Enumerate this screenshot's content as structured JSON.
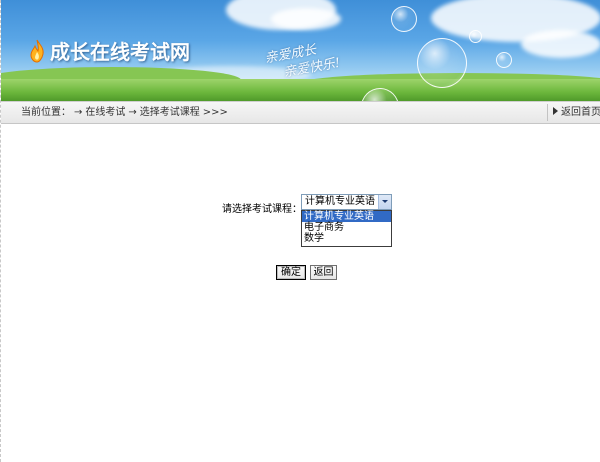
{
  "header": {
    "site_title": "成长在线考试网",
    "slogan_line1": "亲爱成长",
    "slogan_line2": "亲爱快乐!",
    "logo_icon": "flame-icon"
  },
  "breadcrumb": {
    "prefix": "当前位置：",
    "arrow": "→",
    "items": [
      "在线考试",
      "选择考试课程"
    ],
    "tail": ">>>",
    "back_home": "返回首页"
  },
  "form": {
    "course_label": "请选择考试课程：",
    "course_selected": "计算机专业英语",
    "course_options": [
      "计算机专业英语",
      "电子商务",
      "数学"
    ],
    "confirm_label": "确定",
    "back_label": "返回"
  },
  "colors": {
    "sky_top": "#3f8fd8",
    "grass": "#6cb73c",
    "selection": "#316ac5",
    "crumb_bar": "#ececec"
  }
}
